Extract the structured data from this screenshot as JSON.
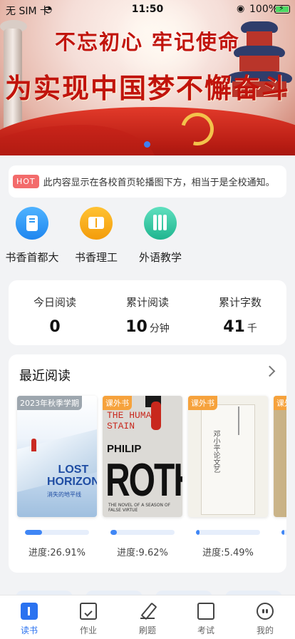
{
  "status": {
    "carrier": "无 SIM 卡",
    "time": "11:50",
    "battery": "100%"
  },
  "banner": {
    "line1": "不忘初心 牢记使命",
    "line2": "为实现中国梦不懈奋斗"
  },
  "notice": {
    "tag": "HOT",
    "text": "此内容显示在各校首页轮播图下方，相当于是全校通知。"
  },
  "shortcuts": [
    {
      "label": "书香首都大",
      "icon": "book-icon",
      "color": "#2f9af2"
    },
    {
      "label": "书香理工",
      "icon": "open-book-icon",
      "color": "#f6a614"
    },
    {
      "label": "外语教学",
      "icon": "books-shelf-icon",
      "color": "#2fc6a2"
    }
  ],
  "stats": [
    {
      "label": "今日阅读",
      "value": "0",
      "unit": ""
    },
    {
      "label": "累计阅读",
      "value": "10",
      "unit": "分钟"
    },
    {
      "label": "累计字数",
      "value": "41",
      "unit": "千"
    }
  ],
  "recent": {
    "title": "最近阅读",
    "books": [
      {
        "badge": "2023年秋季学期",
        "badge_color": "#9aa3ad",
        "cover_title": "LOST HORIZON",
        "cover_subtitle": "消失的地平线",
        "progress": 26.91,
        "progress_text": "进度:26.91%"
      },
      {
        "badge": "课外书",
        "badge_color": "#f6a23c",
        "cover_top": "THE HUMAN STAIN",
        "cover_author_first": "PHILIP",
        "cover_author_last": "ROTH",
        "cover_blurb": "THE NOVEL OF A SEASON OF FALSE VIRTUE",
        "progress": 9.62,
        "progress_text": "进度:9.62%"
      },
      {
        "badge": "课外书",
        "badge_color": "#f6a23c",
        "cover_title": "邓小平论文艺",
        "progress": 5.49,
        "progress_text": "进度:5.49%"
      },
      {
        "badge": "课外书",
        "badge_color": "#f6a23c",
        "progress": 0
      }
    ]
  },
  "tabs": [
    {
      "label": "读书",
      "icon": "book-tab-icon",
      "active": true
    },
    {
      "label": "作业",
      "icon": "homework-icon",
      "active": false
    },
    {
      "label": "刷题",
      "icon": "pen-icon",
      "active": false
    },
    {
      "label": "考试",
      "icon": "exam-icon",
      "active": false
    },
    {
      "label": "我的",
      "icon": "profile-icon",
      "active": false
    }
  ],
  "colors": {
    "accent": "#2a72f0",
    "hot": "#f36b6b",
    "badge": "#f6a23c"
  }
}
